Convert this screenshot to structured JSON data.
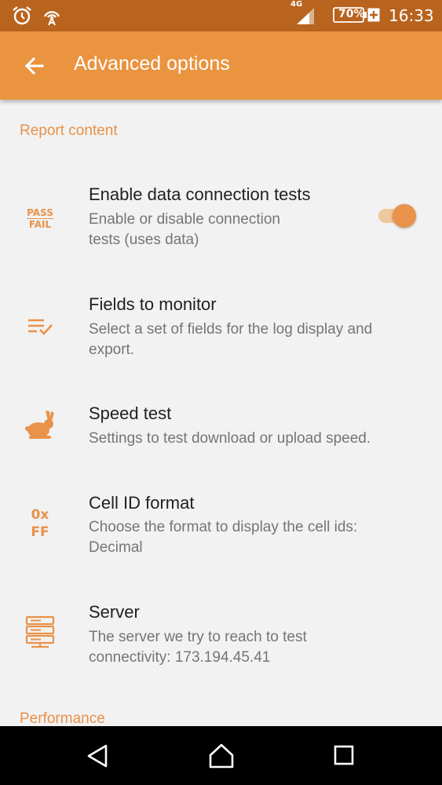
{
  "status_bar": {
    "network_type": "4G",
    "battery_level": "70%",
    "time": "16:33"
  },
  "app_bar": {
    "title": "Advanced options"
  },
  "sections": [
    {
      "header": "Report content",
      "items": [
        {
          "icon_text_top": "PASS",
          "icon_text_bottom": "FAIL",
          "title": "Enable data connection tests",
          "summary_line1": "Enable or disable connection",
          "summary_line2": "tests (uses data)",
          "switch_on": true
        },
        {
          "icon": "checklist-icon",
          "title": "Fields to monitor",
          "summary_line1": "Select a set of fields for the log display and",
          "summary_line2": "export."
        },
        {
          "icon": "rabbit-icon",
          "title": "Speed test",
          "summary_line1": "Settings to test download or upload speed."
        },
        {
          "icon_text_top": "0x",
          "icon_text_bottom": "FF",
          "title": "Cell ID format",
          "summary_line1": "Choose the format to display the cell ids:",
          "summary_line2": "Decimal"
        },
        {
          "icon": "server-icon",
          "title": "Server",
          "summary_line1": "The server we try to reach to test",
          "summary_line2": "connectivity: 173.194.45.41"
        }
      ]
    },
    {
      "header": "Performance"
    }
  ],
  "colors": {
    "status_bar": "#b8631e",
    "app_bar": "#ea9440",
    "accent": "#e8924a",
    "background": "#f2f2f2"
  }
}
